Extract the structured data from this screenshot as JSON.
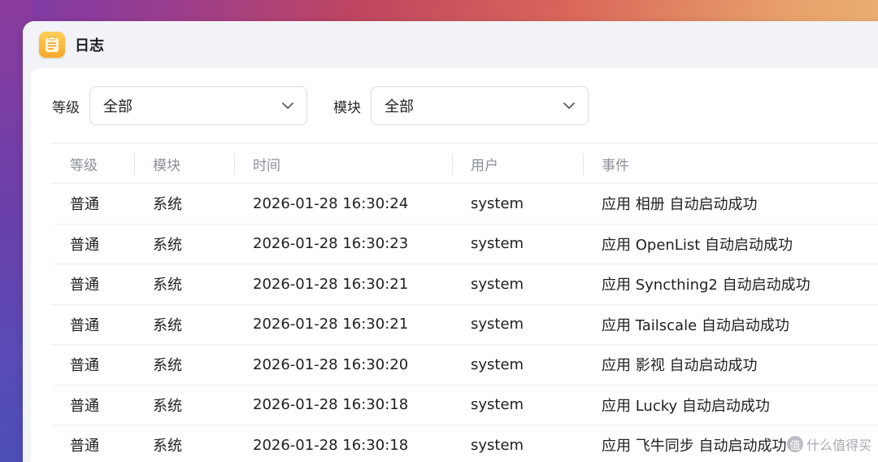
{
  "window": {
    "title": "日志"
  },
  "filters": {
    "level_label": "等级",
    "level_value": "全部",
    "module_label": "模块",
    "module_value": "全部"
  },
  "table": {
    "columns": [
      "等级",
      "模块",
      "时间",
      "用户",
      "事件"
    ],
    "rows": [
      [
        "普通",
        "系统",
        "2026-01-28 16:30:24",
        "system",
        "应用 相册 自动启动成功"
      ],
      [
        "普通",
        "系统",
        "2026-01-28 16:30:23",
        "system",
        "应用 OpenList 自动启动成功"
      ],
      [
        "普通",
        "系统",
        "2026-01-28 16:30:21",
        "system",
        "应用 Syncthing2 自动启动成功"
      ],
      [
        "普通",
        "系统",
        "2026-01-28 16:30:21",
        "system",
        "应用 Tailscale 自动启动成功"
      ],
      [
        "普通",
        "系统",
        "2026-01-28 16:30:20",
        "system",
        "应用 影视 自动启动成功"
      ],
      [
        "普通",
        "系统",
        "2026-01-28 16:30:18",
        "system",
        "应用 Lucky 自动启动成功"
      ],
      [
        "普通",
        "系统",
        "2026-01-28 16:30:18",
        "system",
        "应用 飞牛同步 自动启动成功"
      ]
    ]
  },
  "watermark": {
    "badge": "值",
    "text": "什么值得买"
  },
  "icons": {
    "app": "log-app-icon",
    "dropdown": "chevron-down-icon"
  }
}
